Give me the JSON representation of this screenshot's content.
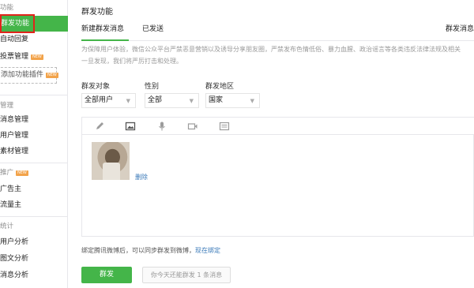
{
  "sidebar": {
    "sections": [
      {
        "label": "功能",
        "items": [
          {
            "label": "群发功能",
            "active": true
          },
          {
            "label": "自动回复"
          },
          {
            "label": "投票管理",
            "badge": "NEW"
          }
        ]
      },
      {
        "label": "管理",
        "items": [
          {
            "label": "消息管理"
          },
          {
            "label": "用户管理"
          },
          {
            "label": "素材管理"
          }
        ]
      },
      {
        "label": "推广",
        "badge": "NEW",
        "items": [
          {
            "label": "广告主"
          },
          {
            "label": "流量主"
          }
        ]
      },
      {
        "label": "统计",
        "items": [
          {
            "label": "用户分析"
          },
          {
            "label": "图文分析"
          },
          {
            "label": "消息分析"
          }
        ]
      }
    ],
    "add_plugin": {
      "label": "添加功能插件",
      "badge": "NEW"
    }
  },
  "main": {
    "title": "群发功能",
    "tabs": [
      {
        "label": "新建群发消息",
        "active": true
      },
      {
        "label": "已发送"
      },
      {
        "label": "群发消息"
      }
    ],
    "notice_line1": "为保障用户体验，微信公众平台严禁恶意营销以及诱导分享朋友圈，严禁发布色情低俗、暴力血腥、政治谣言等各类违反法律法规及相关",
    "notice_line2": "一旦发现，我们将严厉打击和处理。",
    "filters": {
      "target": {
        "label": "群发对象",
        "value": "全部用户"
      },
      "gender": {
        "label": "性别",
        "value": "全部"
      },
      "region": {
        "label": "群发地区",
        "value": "国家"
      }
    },
    "editor": {
      "tools": [
        "pencil-icon",
        "image-icon",
        "microphone-icon",
        "video-icon",
        "card-icon"
      ],
      "delete_label": "删除"
    },
    "bind_hint": {
      "text": "绑定腾讯微博后，可以同步群发到微博，",
      "link": "现在绑定"
    },
    "send_button": "群发",
    "quota_text": "你今天还能群发 1 条消息"
  },
  "colors": {
    "accent": "#44b549",
    "link": "#3b7ab9",
    "active_frame": "#e0241b",
    "new_badge": "#f2a34a"
  }
}
